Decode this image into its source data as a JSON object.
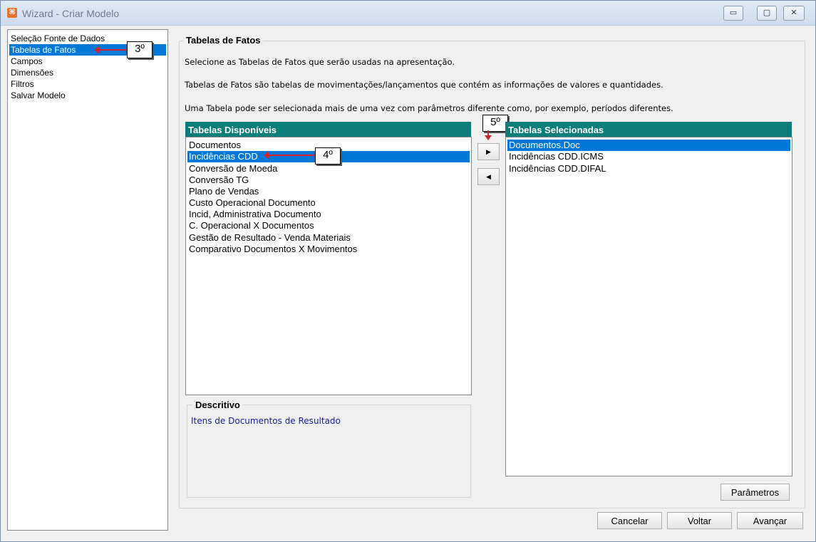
{
  "window": {
    "title": "Wizard - Criar Modelo",
    "icon": "app-logo-icon",
    "controls": {
      "minimize": "▭",
      "restore": "▢",
      "close": "✕"
    }
  },
  "nav": {
    "items": [
      {
        "label": "Seleção Fonte de Dados",
        "selected": false
      },
      {
        "label": "Tabelas de Fatos",
        "selected": true
      },
      {
        "label": "Campos",
        "selected": false
      },
      {
        "label": "Dimensões",
        "selected": false
      },
      {
        "label": "Filtros",
        "selected": false
      },
      {
        "label": "Salvar Modelo",
        "selected": false
      }
    ]
  },
  "annotations": {
    "step3": "3º",
    "step4": "4º",
    "step5": "5º"
  },
  "main": {
    "group_title": "Tabelas de Fatos",
    "paragraphs": [
      "Selecione as Tabelas de Fatos que serão usadas na apresentação.",
      "Tabelas de Fatos são tabelas de movimentações/lançamentos que contém as informações de valores e quantidades.",
      "Uma Tabela pode ser selecionada mais de uma vez com parâmetros diferente como, por exemplo, períodos diferentes."
    ],
    "available": {
      "header": "Tabelas Disponíveis",
      "items": [
        "Documentos",
        "Incidências CDD",
        "Conversão de Moeda",
        "Conversão TG",
        "Plano de Vendas",
        "Custo Operacional Documento",
        "Incid, Administrativa Documento",
        "C. Operacional X Documentos",
        "Gestão de Resultado - Venda Materiais",
        "Comparativo Documentos X  Movimentos"
      ],
      "selected_index": 1
    },
    "selected": {
      "header": "Tabelas Selecionadas",
      "items": [
        "Documentos.Doc",
        "Incidências CDD.ICMS",
        "Incidências CDD.DIFAL"
      ],
      "selected_index": 0
    },
    "move_right": "▶",
    "move_left": "◀",
    "descritivo": {
      "title": "Descritivo",
      "text": "Itens de Documentos de Resultado"
    },
    "parametros_button": "Parâmetros"
  },
  "footer": {
    "cancel": "Cancelar",
    "back": "Voltar",
    "next": "Avançar"
  },
  "colors": {
    "selection": "#0078d7",
    "list_header": "#0d7d7a",
    "annotation_arrow": "#d4202a",
    "description_text": "#1a1a9a"
  }
}
